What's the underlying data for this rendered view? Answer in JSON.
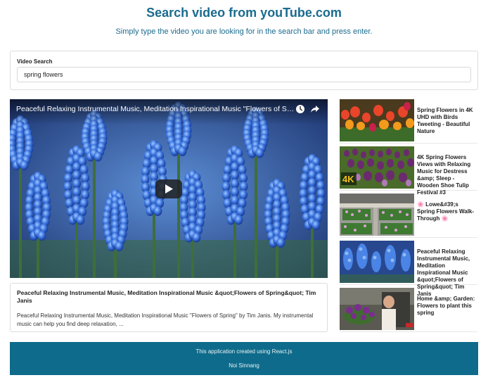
{
  "header": {
    "title": "Search video from youTube.com",
    "subtitle": "Simply type the video you are looking for in the search bar and press enter."
  },
  "search": {
    "label": "Video Search",
    "value": "spring flowers"
  },
  "player": {
    "title": "Peaceful Relaxing Instrumental Music, Meditation Inspirational Music \"Flowers of Spring\" by Tim Janis",
    "icons": [
      "watch-later-icon",
      "share-icon",
      "play-icon"
    ]
  },
  "detail": {
    "title": "Peaceful Relaxing Instrumental Music, Meditation Inspirational Music &quot;Flowers of Spring&quot; Tim Janis",
    "description": "Peaceful Relaxing Instrumental Music, Meditation Inspirational Music \"Flowers of Spring\" by Tim Janis. My instrumental music can help you find deep relaxation, ..."
  },
  "video_list": [
    {
      "title": "Spring Flowers in 4K UHD with Birds Tweeting - Beautiful Nature"
    },
    {
      "title": "4K Spring Flowers Views with Relaxing Music for Destress &amp; Sleep - Wooden Shoe Tulip Festival #3",
      "thumb_badge": "4K"
    },
    {
      "title": "🌸 Lowe&#39;s Spring Flowers Walk-Through 🌸"
    },
    {
      "title": "Peaceful Relaxing Instrumental Music, Meditation Inspirational Music &quot;Flowers of Spring&quot; Tim Janis"
    },
    {
      "title": "Home &amp; Garden: Flowers to plant this spring"
    }
  ],
  "footer": {
    "line1": "This application created using React.js",
    "line2": "Noi Sinnang"
  },
  "colors": {
    "accent": "#1a6b8f",
    "footer_bg": "#0e6b8b"
  }
}
